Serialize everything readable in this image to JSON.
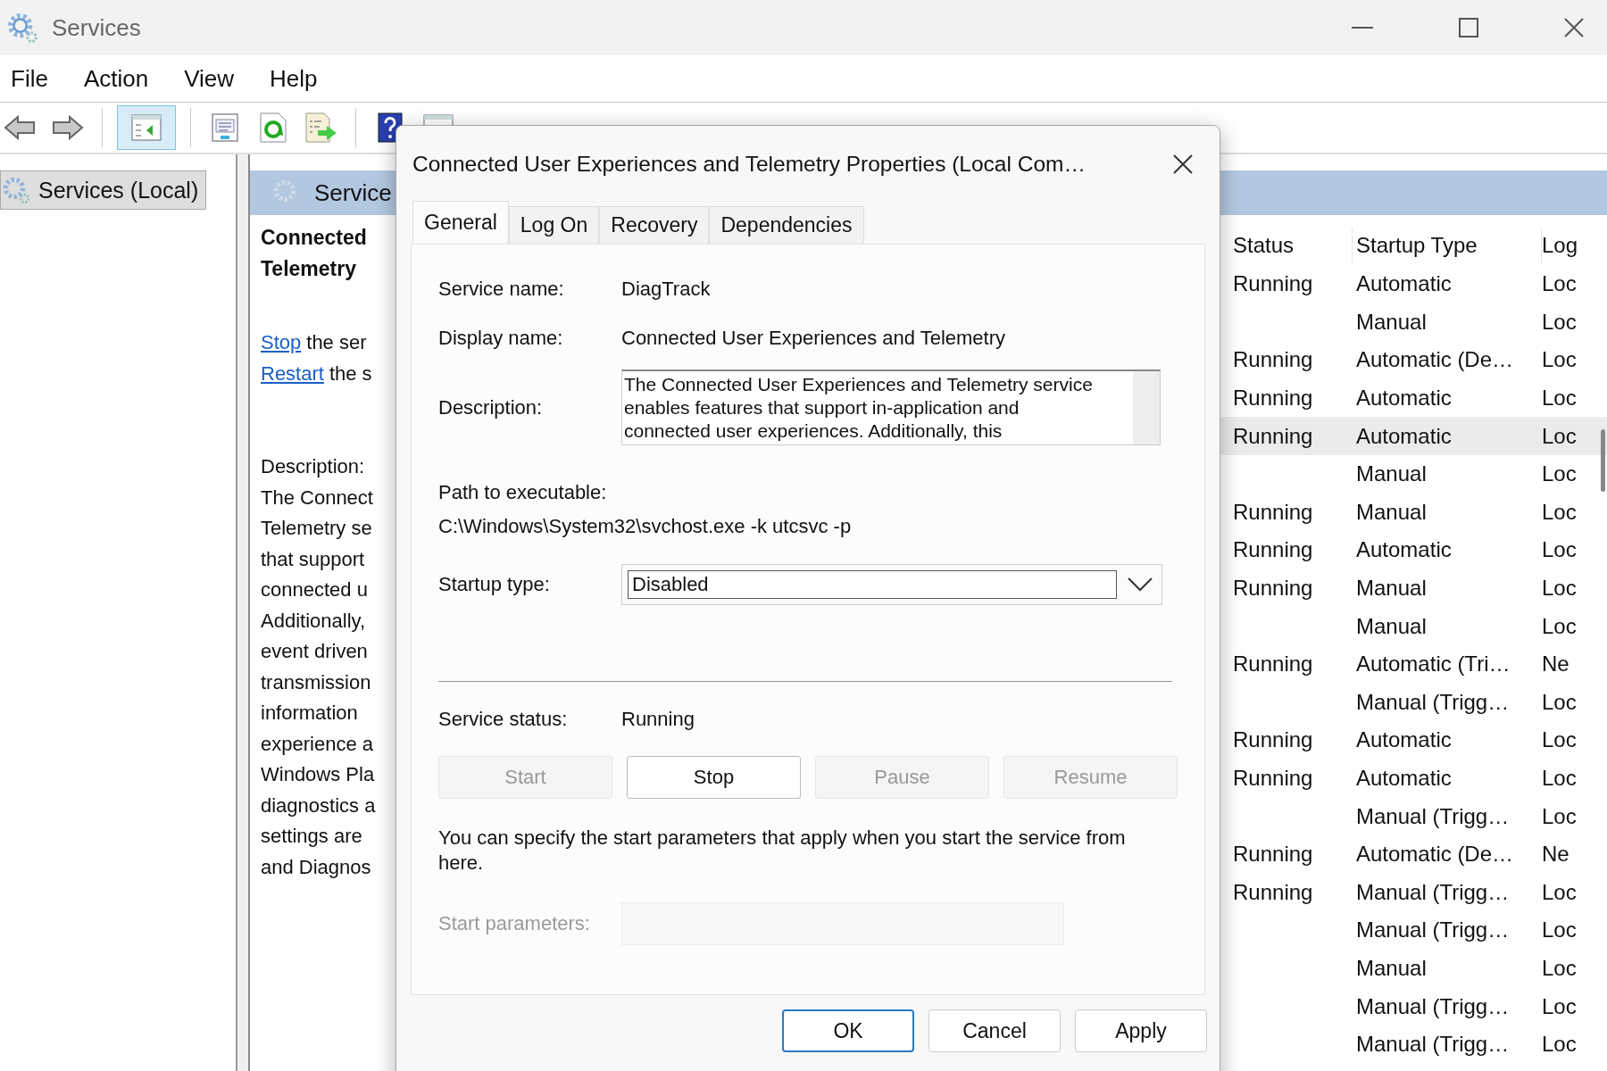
{
  "window": {
    "title": "Services"
  },
  "menu": [
    "File",
    "Action",
    "View",
    "Help"
  ],
  "toolbar": [
    {
      "kind": "back",
      "pressed": false
    },
    {
      "kind": "forward",
      "pressed": false
    },
    {
      "kind": "separator"
    },
    {
      "kind": "console-tree",
      "pressed": true
    },
    {
      "kind": "separator"
    },
    {
      "kind": "properties",
      "pressed": false
    },
    {
      "kind": "refresh",
      "pressed": false
    },
    {
      "kind": "export",
      "pressed": false
    },
    {
      "kind": "separator"
    },
    {
      "kind": "help",
      "pressed": false
    },
    {
      "kind": "action-pane",
      "pressed": false
    }
  ],
  "tree": {
    "items": [
      {
        "label": "Services (Local)",
        "selected": true
      }
    ]
  },
  "details": {
    "header": "Service",
    "title_lines": [
      "Connected",
      "Telemetry"
    ],
    "actions": [
      {
        "link": "Stop",
        "text": "the ser"
      },
      {
        "link": "Restart",
        "text": "the s"
      }
    ],
    "description_label": "Description:",
    "description_lines": [
      "The Connect",
      "Telemetry se",
      "that support",
      "connected u",
      "Additionally,",
      "event driven",
      "transmission",
      "information",
      "experience a",
      "Windows Pla",
      "diagnostics a",
      "settings are",
      "and Diagnos"
    ]
  },
  "list": {
    "columns": [
      "Status",
      "Startup Type",
      "Log"
    ],
    "rows": [
      {
        "status": "Running",
        "startup_type": "Automatic",
        "log": "Loc",
        "selected": false
      },
      {
        "status": "",
        "startup_type": "Manual",
        "log": "Loc",
        "selected": false
      },
      {
        "status": "Running",
        "startup_type": "Automatic (De…",
        "log": "Loc",
        "selected": false
      },
      {
        "status": "Running",
        "startup_type": "Automatic",
        "log": "Loc",
        "selected": false
      },
      {
        "status": "Running",
        "startup_type": "Automatic",
        "log": "Loc",
        "selected": true
      },
      {
        "status": "",
        "startup_type": "Manual",
        "log": "Loc",
        "selected": false
      },
      {
        "status": "Running",
        "startup_type": "Manual",
        "log": "Loc",
        "selected": false
      },
      {
        "status": "Running",
        "startup_type": "Automatic",
        "log": "Loc",
        "selected": false
      },
      {
        "status": "Running",
        "startup_type": "Manual",
        "log": "Loc",
        "selected": false
      },
      {
        "status": "",
        "startup_type": "Manual",
        "log": "Loc",
        "selected": false
      },
      {
        "status": "Running",
        "startup_type": "Automatic (Tri…",
        "log": "Ne",
        "selected": false
      },
      {
        "status": "",
        "startup_type": "Manual (Trigg…",
        "log": "Loc",
        "selected": false
      },
      {
        "status": "Running",
        "startup_type": "Automatic",
        "log": "Loc",
        "selected": false
      },
      {
        "status": "Running",
        "startup_type": "Automatic",
        "log": "Loc",
        "selected": false
      },
      {
        "status": "",
        "startup_type": "Manual (Trigg…",
        "log": "Loc",
        "selected": false
      },
      {
        "status": "Running",
        "startup_type": "Automatic (De…",
        "log": "Ne",
        "selected": false
      },
      {
        "status": "Running",
        "startup_type": "Manual (Trigg…",
        "log": "Loc",
        "selected": false
      },
      {
        "status": "",
        "startup_type": "Manual (Trigg…",
        "log": "Loc",
        "selected": false
      },
      {
        "status": "",
        "startup_type": "Manual",
        "log": "Loc",
        "selected": false
      },
      {
        "status": "",
        "startup_type": "Manual (Trigg…",
        "log": "Loc",
        "selected": false
      },
      {
        "status": "",
        "startup_type": "Manual (Trigg…",
        "log": "Loc",
        "selected": false
      }
    ]
  },
  "dialog": {
    "title": "Connected User Experiences and Telemetry Properties (Local Com…",
    "tabs": [
      {
        "label": "General",
        "selected": true
      },
      {
        "label": "Log On",
        "selected": false
      },
      {
        "label": "Recovery",
        "selected": false
      },
      {
        "label": "Dependencies",
        "selected": false
      }
    ],
    "fields": [
      {
        "label": "Service name:",
        "value": "DiagTrack"
      },
      {
        "label": "Display name:",
        "value": "Connected User Experiences and Telemetry"
      }
    ],
    "description": {
      "label": "Description:",
      "value": "The Connected User Experiences and Telemetry service enables features that support in-application and connected user experiences. Additionally, this"
    },
    "path": {
      "label": "Path to executable:",
      "value": "C:\\Windows\\System32\\svchost.exe -k utcsvc -p"
    },
    "startup_type": {
      "label": "Startup type:",
      "value": "Disabled"
    },
    "service_status": {
      "label": "Service status:",
      "value": "Running"
    },
    "service_buttons": [
      {
        "label": "Start",
        "disabled": true
      },
      {
        "label": "Stop",
        "disabled": false
      },
      {
        "label": "Pause",
        "disabled": true
      },
      {
        "label": "Resume",
        "disabled": true
      }
    ],
    "note": "You can specify the start parameters that apply when you start the service from here.",
    "start_parameters": {
      "label": "Start parameters:",
      "disabled": true
    },
    "buttons": [
      {
        "label": "OK",
        "default": true
      },
      {
        "label": "Cancel",
        "default": false
      },
      {
        "label": "Apply",
        "default": false
      }
    ]
  }
}
